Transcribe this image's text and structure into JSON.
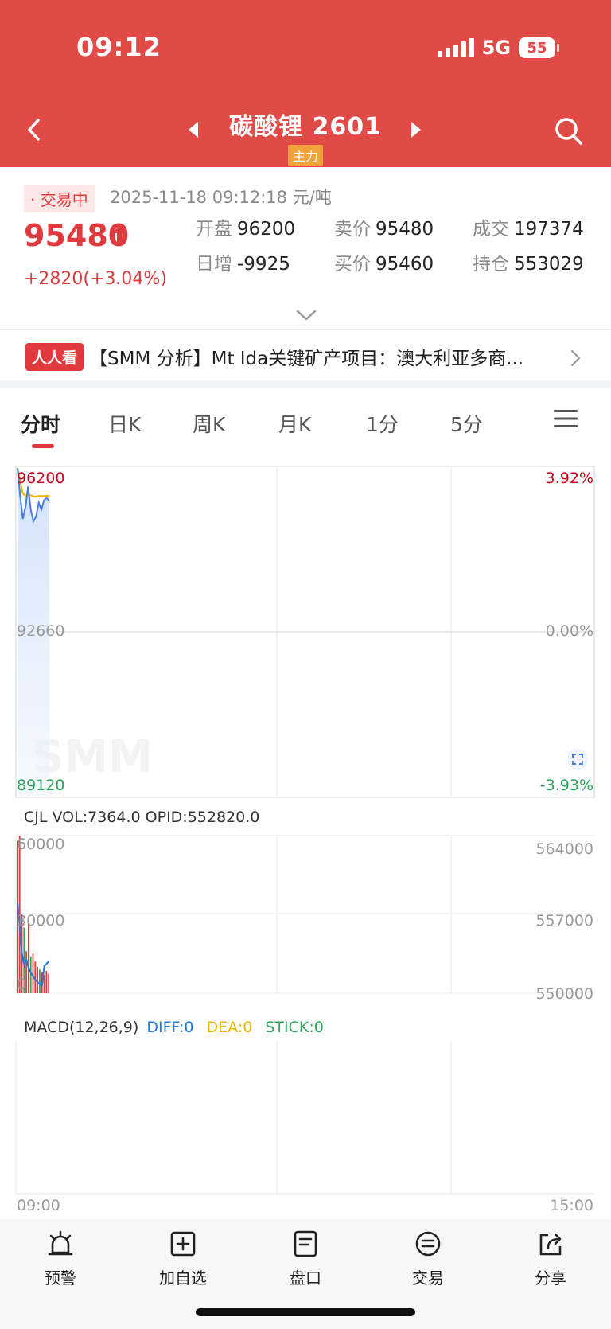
{
  "status_bar": {
    "time": "09:12",
    "network": "5G",
    "battery": "55"
  },
  "header": {
    "title": "碳酸锂 2601",
    "tag": "主力"
  },
  "quote": {
    "trade_status": "· 交易中",
    "timestamp": "2025-11-18 09:12:18",
    "unit": "元/吨",
    "last_price": "95480",
    "change": "+2820(+3.04%)",
    "stats": [
      {
        "label": "开盘",
        "value": "96200"
      },
      {
        "label": "卖价",
        "value": "95480"
      },
      {
        "label": "成交",
        "value": "197374"
      },
      {
        "label": "日增",
        "value": "-9925"
      },
      {
        "label": "买价",
        "value": "95460"
      },
      {
        "label": "持仓",
        "value": "553029"
      }
    ]
  },
  "news": {
    "tag": "人人看",
    "text": "【SMM 分析】Mt Ida关键矿产项目：澳大利亚多商..."
  },
  "tabs": [
    "分时",
    "日K",
    "周K",
    "月K",
    "1分",
    "5分"
  ],
  "active_tab": 0,
  "chart_data": [
    {
      "type": "line",
      "x": [
        0,
        1,
        2,
        3,
        4,
        5,
        6,
        7,
        8,
        9,
        10,
        11,
        12
      ],
      "series": [
        {
          "values": [
            96200,
            95600,
            95100,
            95350,
            95800,
            95300,
            95050,
            95150,
            95450,
            95300,
            95500,
            95550,
            95480
          ],
          "color": "#4b7ee0"
        },
        {
          "values": [
            96200,
            95900,
            95650,
            95600,
            95620,
            95610,
            95590,
            95580,
            95600,
            95590,
            95595,
            95600,
            95600
          ],
          "color": "#f0b400"
        }
      ],
      "ylim": [
        89120,
        96200
      ],
      "y_left_labels": [
        "96200",
        "92660",
        "89120"
      ],
      "y_right_labels": [
        "3.92%",
        "0.00%",
        "-3.93%"
      ],
      "watermark": "SMM"
    },
    {
      "type": "bar",
      "indicator": {
        "name": "CJL",
        "vol": "VOL:7364.0",
        "opid": "OPID:552820.0"
      },
      "values": [
        58000,
        60000,
        30000,
        25000,
        16000,
        28000,
        14000,
        15000,
        12000,
        10000,
        9000,
        8000,
        7000,
        8500,
        7364
      ],
      "colors": [
        "#e0393e",
        "#e0393e",
        "#e0393e",
        "#2aa65a",
        "#e0393e",
        "#e0393e",
        "#2aa65a",
        "#e0393e",
        "#e0393e",
        "#e0393e",
        "#2aa65a",
        "#e0393e",
        "#e0393e",
        "#e0393e",
        "#e0393e"
      ],
      "line": [
        558000,
        556000,
        553500,
        552500,
        553000,
        552200,
        551800,
        551500,
        551200,
        551000,
        550800,
        550700,
        552400,
        552600,
        552820
      ],
      "ylim_left": [
        0,
        60000
      ],
      "ylim_right": [
        550000,
        564000
      ],
      "y_left_labels": [
        "60000",
        "30000",
        "0"
      ],
      "y_right_labels": [
        "564000",
        "557000",
        "550000"
      ]
    },
    {
      "type": "line",
      "indicator": {
        "name": "MACD(12,26,9)",
        "diff": "DIFF:0",
        "dea": "DEA:0",
        "stick": "STICK:0"
      },
      "x_labels": [
        "09:00",
        "15:00"
      ]
    }
  ],
  "bottom_nav": [
    {
      "label": "预警",
      "icon": "alarm-icon"
    },
    {
      "label": "加自选",
      "icon": "add-box-icon"
    },
    {
      "label": "盘口",
      "icon": "orderbook-icon"
    },
    {
      "label": "交易",
      "icon": "trade-icon"
    },
    {
      "label": "分享",
      "icon": "share-icon"
    }
  ],
  "colors": {
    "brand": "#e04b47",
    "up": "#e0393e",
    "down": "#2aa65a"
  }
}
